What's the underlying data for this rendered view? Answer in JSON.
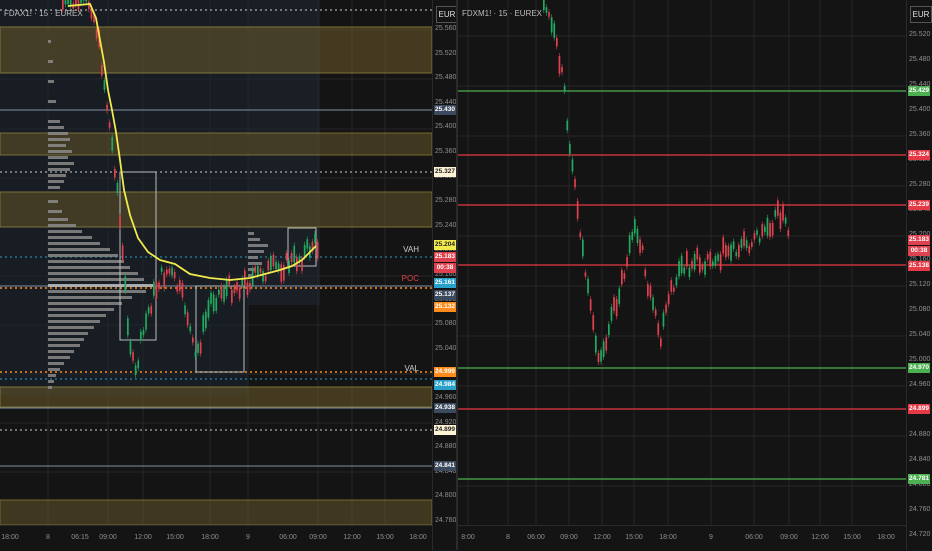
{
  "colors": {
    "bg": "#141414",
    "grid": "#262626",
    "axis_text": "#8f8f8f",
    "up": "#22ab60",
    "down": "#e0414f",
    "zone_fill": "#6b5a2a",
    "zone_line": "#d8c04b",
    "vwap": "#f2ea4d",
    "green_line": "#4caf50",
    "red_line": "#e53945",
    "orange_dots": "#ff8c1a",
    "cyan_dots": "#2aa1c9",
    "white_dots": "#cfcfcf"
  },
  "left_pane": {
    "symbol": "FDAX1! · 15 · EUREX",
    "currency": "EUR",
    "axis_ticks": [
      "25.560",
      "25.520",
      "25.480",
      "25.440",
      "25.400",
      "25.360",
      "25.320",
      "25.280",
      "25.240",
      "25.200",
      "25.160",
      "25.120",
      "25.080",
      "25.040",
      "25.000",
      "24.960",
      "24.920",
      "24.880",
      "24.840",
      "24.800",
      "24.760"
    ],
    "time_labels": [
      "18:00",
      "8",
      "06:15",
      "09:00",
      "12:00",
      "15:00",
      "18:00",
      "9",
      "06:00",
      "09:00",
      "12:00",
      "15:00",
      "18:00"
    ],
    "tags": [
      {
        "text": "25.430",
        "bg": "#3c4a5e",
        "fg": "#ffffff"
      },
      {
        "text": "25.327",
        "bg": "#fff3d6",
        "fg": "#222222"
      },
      {
        "text": "25.204",
        "bg": "#f2ea4d",
        "fg": "#222222"
      },
      {
        "text": "25.183",
        "bg": "#e0414f",
        "fg": "#ffffff"
      },
      {
        "text": "00:38",
        "bg": "#e0414f",
        "fg": "#ffffff"
      },
      {
        "text": "25.161",
        "bg": "#2aa1c9",
        "fg": "#ffffff"
      },
      {
        "text": "25.137",
        "bg": "#3c4a5e",
        "fg": "#ffffff"
      },
      {
        "text": "25.132",
        "bg": "#ff8c1a",
        "fg": "#ffffff"
      },
      {
        "text": "24.999",
        "bg": "#ff8c1a",
        "fg": "#ffffff"
      },
      {
        "text": "24.984",
        "bg": "#2aa1c9",
        "fg": "#ffffff"
      },
      {
        "text": "24.938",
        "bg": "#3c4a5e",
        "fg": "#ffffff"
      },
      {
        "text": "24.899",
        "bg": "#fff3d6",
        "fg": "#222222"
      },
      {
        "text": "24.841",
        "bg": "#3c4a5e",
        "fg": "#ffffff"
      }
    ],
    "labels": {
      "vah": "VAH",
      "poc": "POC",
      "val": "VAL"
    }
  },
  "right_pane": {
    "symbol": "FDXM1! · 15 · EUREX",
    "currency": "EUR",
    "axis_ticks": [
      "25.520",
      "25.480",
      "25.440",
      "25.400",
      "25.360",
      "25.320",
      "25.280",
      "25.240",
      "25.200",
      "25.160",
      "25.120",
      "25.080",
      "25.040",
      "25.000",
      "24.960",
      "24.920",
      "24.880",
      "24.840",
      "24.800",
      "24.760",
      "24.720"
    ],
    "time_labels": [
      "8:00",
      "8",
      "06:00",
      "09:00",
      "12:00",
      "15:00",
      "18:00",
      "9",
      "06:00",
      "09:00",
      "12:00",
      "15:00",
      "18:00"
    ],
    "tags": [
      {
        "text": "25.429",
        "bg": "#4caf50",
        "fg": "#ffffff"
      },
      {
        "text": "25.324",
        "bg": "#e53945",
        "fg": "#ffffff"
      },
      {
        "text": "25.239",
        "bg": "#e53945",
        "fg": "#ffffff"
      },
      {
        "text": "25.183",
        "bg": "#e0414f",
        "fg": "#ffffff"
      },
      {
        "text": "00:38",
        "bg": "#e0414f",
        "fg": "#ffffff"
      },
      {
        "text": "25.138",
        "bg": "#e53945",
        "fg": "#ffffff"
      },
      {
        "text": "24.970",
        "bg": "#4caf50",
        "fg": "#ffffff"
      },
      {
        "text": "24.899",
        "bg": "#e53945",
        "fg": "#ffffff"
      },
      {
        "text": "24.781",
        "bg": "#4caf50",
        "fg": "#ffffff"
      }
    ]
  }
}
